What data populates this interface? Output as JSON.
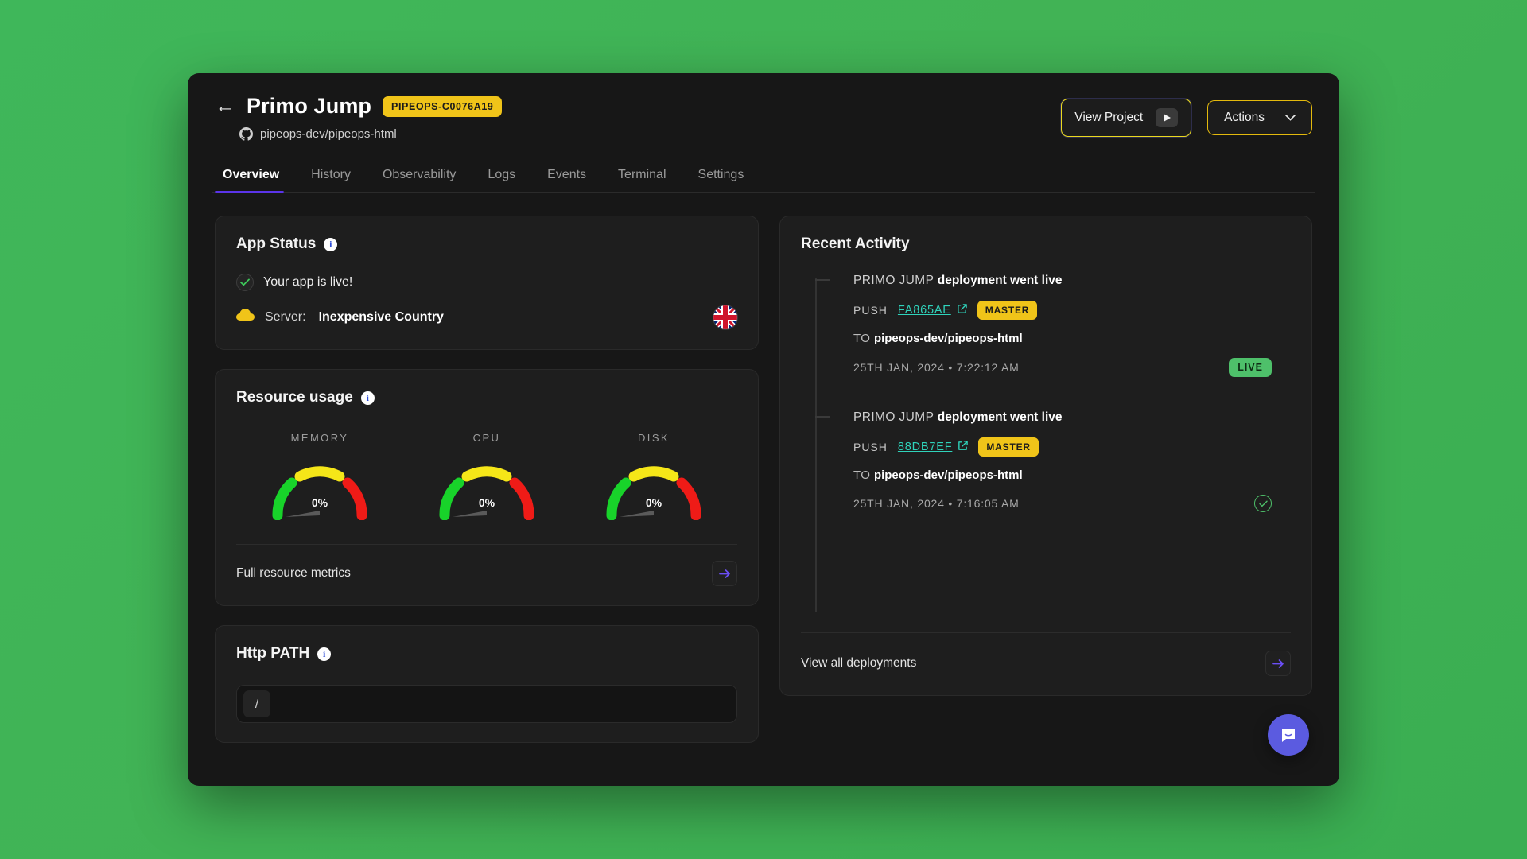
{
  "header": {
    "back_icon": "back-arrow-icon",
    "title": "Primo Jump",
    "id_badge": "PIPEOPS-C0076A19",
    "repo_icon": "github-icon",
    "repo": "pipeops-dev/pipeops-html",
    "view_project_label": "View Project",
    "view_project_icon": "play-icon",
    "actions_label": "Actions",
    "actions_icon": "chevron-down-icon"
  },
  "tabs": [
    {
      "label": "Overview",
      "active": true
    },
    {
      "label": "History",
      "active": false
    },
    {
      "label": "Observability",
      "active": false
    },
    {
      "label": "Logs",
      "active": false
    },
    {
      "label": "Events",
      "active": false
    },
    {
      "label": "Terminal",
      "active": false
    },
    {
      "label": "Settings",
      "active": false
    }
  ],
  "app_status": {
    "title": "App Status",
    "info_icon": "info-icon",
    "status_icon": "check-circle-icon",
    "status_text": "Your app is live!",
    "server_icon": "cloud-icon",
    "server_label": "Server:",
    "server_name": "Inexpensive Country",
    "flag_icon": "uk-flag-icon"
  },
  "resource_usage": {
    "title": "Resource usage",
    "info_icon": "info-icon",
    "gauges": [
      {
        "label": "MEMORY",
        "value": "0%",
        "percent": 0
      },
      {
        "label": "CPU",
        "value": "0%",
        "percent": 0
      },
      {
        "label": "DISK",
        "value": "0%",
        "percent": 0
      }
    ],
    "footer_label": "Full resource metrics",
    "footer_icon": "arrow-right-icon"
  },
  "http_path": {
    "title": "Http PATH",
    "info_icon": "info-icon",
    "value": "/",
    "placeholder": "/"
  },
  "recent_activity": {
    "title": "Recent Activity",
    "items": [
      {
        "app_name": "PRIMO JUMP",
        "event": "deployment went live",
        "action": "PUSH",
        "commit": "FA865AE",
        "commit_icon": "external-link-icon",
        "branch": "MASTER",
        "to_label": "TO",
        "repo": "pipeops-dev/pipeops-html",
        "timestamp": "25TH JAN, 2024 • 7:22:12 AM",
        "status": "LIVE",
        "status_type": "badge"
      },
      {
        "app_name": "PRIMO JUMP",
        "event": "deployment went live",
        "action": "PUSH",
        "commit": "88DB7EF",
        "commit_icon": "external-link-icon",
        "branch": "MASTER",
        "to_label": "TO",
        "repo": "pipeops-dev/pipeops-html",
        "timestamp": "25TH JAN, 2024 • 7:16:05 AM",
        "status": "",
        "status_type": "check"
      }
    ],
    "footer_label": "View all deployments",
    "footer_icon": "arrow-right-icon"
  },
  "chat": {
    "icon": "chat-bubble-icon"
  },
  "colors": {
    "page_backdrop": "#41b355",
    "window_bg": "#171717",
    "card_bg": "#1e1e1e",
    "accent_yellow": "#f0c419",
    "accent_purple": "#5b34ea",
    "accent_teal": "#2fd3bb",
    "accent_green": "#4ec06a",
    "gauge_green": "#18d32a",
    "gauge_yellow": "#f5e618",
    "gauge_red": "#ef1b17"
  }
}
